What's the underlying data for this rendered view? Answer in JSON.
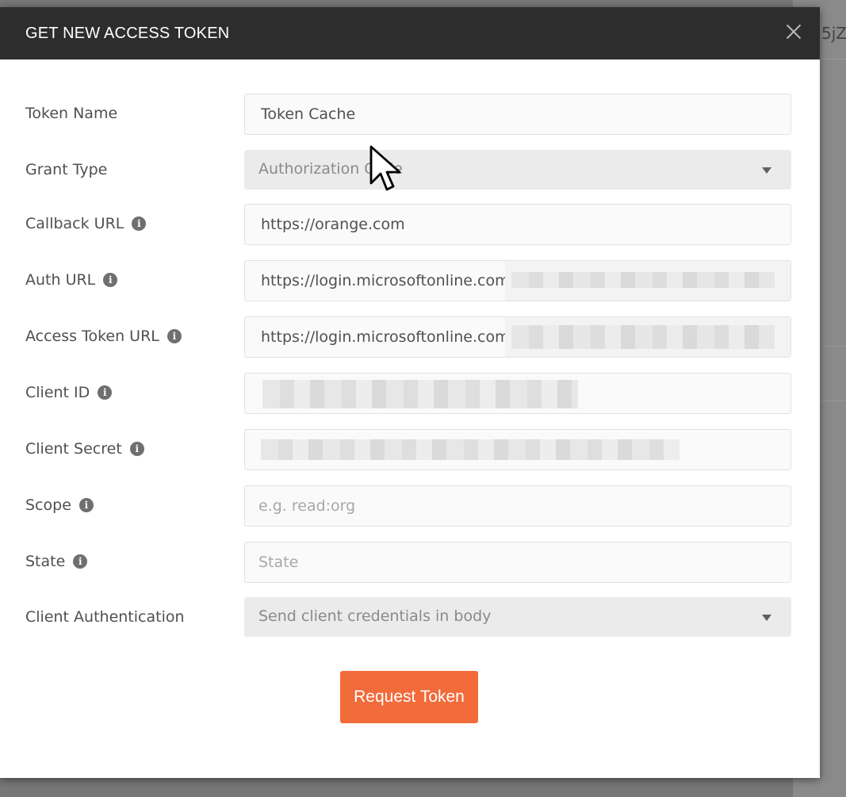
{
  "background": {
    "partial_text": "5jZ"
  },
  "dialog": {
    "title": "GET NEW ACCESS TOKEN",
    "close_symbol": "×"
  },
  "form": {
    "token_name": {
      "label": "Token Name",
      "value": "Token Cache"
    },
    "grant_type": {
      "label": "Grant Type",
      "value": "Authorization Code"
    },
    "callback_url": {
      "label": "Callback URL",
      "value": "https://orange.com"
    },
    "auth_url": {
      "label": "Auth URL",
      "value": "https://login.microsoftonline.com"
    },
    "access_token_url": {
      "label": "Access Token URL",
      "value": "https://login.microsoftonline.com"
    },
    "client_id": {
      "label": "Client ID",
      "value": ""
    },
    "client_secret": {
      "label": "Client Secret",
      "value": ""
    },
    "scope": {
      "label": "Scope",
      "placeholder": "e.g. read:org"
    },
    "state": {
      "label": "State",
      "placeholder": "State"
    },
    "client_authentication": {
      "label": "Client Authentication",
      "value": "Send client credentials in body"
    }
  },
  "actions": {
    "request_token_label": "Request Token"
  },
  "colors": {
    "header_bg": "#2d2d2d",
    "button_bg": "#f26b3a"
  },
  "icons": {
    "info": "info-icon",
    "close": "close-icon",
    "dropdown": "chevron-down-icon",
    "cursor": "mouse-pointer-icon"
  }
}
